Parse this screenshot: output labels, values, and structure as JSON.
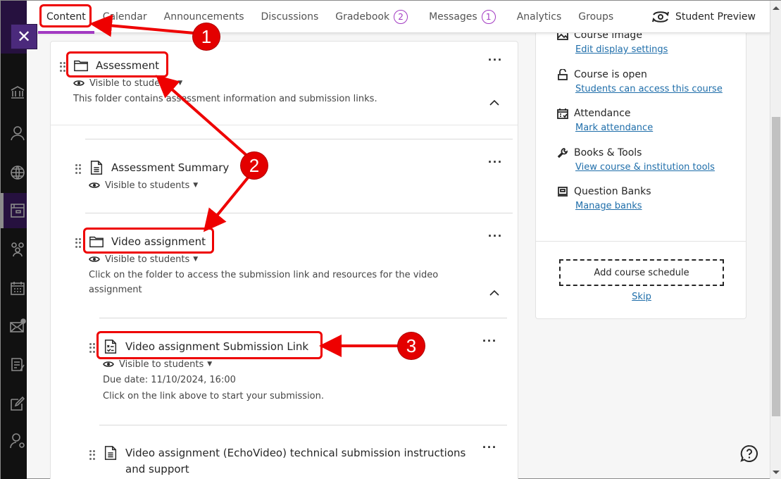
{
  "nav": {
    "tabs": [
      {
        "label": "Content",
        "active": true
      },
      {
        "label": "Calendar"
      },
      {
        "label": "Announcements"
      },
      {
        "label": "Discussions"
      },
      {
        "label": "Gradebook",
        "badge": "2"
      },
      {
        "label": "Messages",
        "badge": "1"
      },
      {
        "label": "Analytics"
      },
      {
        "label": "Groups"
      }
    ],
    "student_preview": "Student Preview",
    "close_label": "✕"
  },
  "rail": {
    "icons": [
      "institution-icon",
      "profile-icon",
      "globe-icon",
      "courses-icon",
      "groups-icon",
      "calendar-icon",
      "messages-icon",
      "grades-icon",
      "edit-icon",
      "user-settings-icon"
    ]
  },
  "content": {
    "folder": {
      "title": "Assessment",
      "visibility": "Visible to students",
      "description": "This folder contains assessment information and submission links."
    },
    "summary": {
      "title": "Assessment Summary",
      "visibility": "Visible to students"
    },
    "video_folder": {
      "title": "Video assignment",
      "visibility": "Visible to students",
      "description": "Click on the folder to access the submission link and resources for the video assignment"
    },
    "submission": {
      "title": "Video assignment Submission Link",
      "visibility": "Visible to students",
      "due_date": "Due date: 11/10/2024, 16:00",
      "description": "Click on the link above to start your submission."
    },
    "instructions": {
      "title": "Video assignment (EchoVideo) technical submission instructions and support"
    }
  },
  "details": {
    "items": [
      {
        "heading": "Course image",
        "link": "Edit display settings",
        "icon": "image-icon"
      },
      {
        "heading": "Course is open",
        "link": "Students can access this course",
        "icon": "unlock-icon"
      },
      {
        "heading": "Attendance",
        "link": "Mark attendance",
        "icon": "attendance-icon"
      },
      {
        "heading": "Books & Tools",
        "link": "View course & institution tools",
        "icon": "wrench-icon"
      },
      {
        "heading": "Question Banks",
        "link": "Manage banks",
        "icon": "question-bank-icon"
      }
    ],
    "schedule_button": "Add course schedule",
    "skip": "Skip"
  },
  "callouts": [
    "1",
    "2",
    "3"
  ],
  "colors": {
    "accent": "#a23ac2",
    "link": "#1f6eaa",
    "annotation": "#e30000",
    "rail": "#111111",
    "rail_active": "#26113f"
  }
}
